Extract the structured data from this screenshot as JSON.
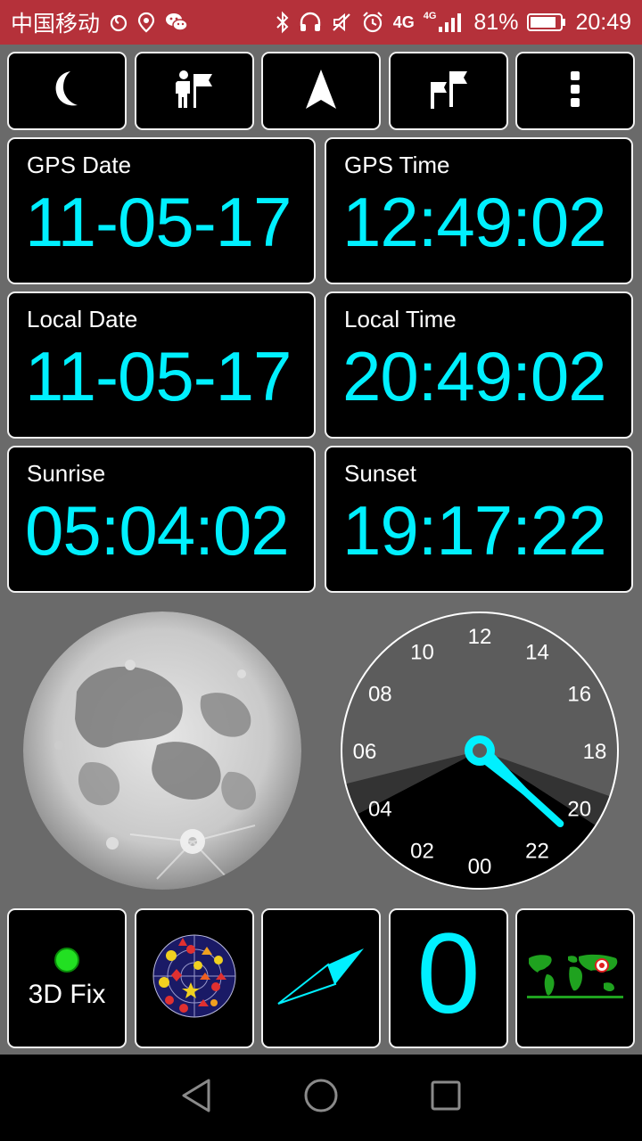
{
  "status_bar": {
    "carrier": "中国移动",
    "network": "4G",
    "network_small": "4G",
    "battery": "81%",
    "time": "20:49",
    "icons": [
      "shield-icon",
      "location-icon",
      "wechat-icon",
      "bluetooth-icon",
      "headphones-icon",
      "mute-icon",
      "alarm-icon",
      "signal-icon",
      "battery-icon"
    ]
  },
  "toolbar": {
    "buttons": [
      "moon-icon",
      "hiker-icon",
      "navigation-arrow-icon",
      "flags-icon",
      "more-vertical-icon"
    ]
  },
  "info": {
    "gps_date": {
      "label": "GPS Date",
      "value": "11-05-17"
    },
    "gps_time": {
      "label": "GPS Time",
      "value": "12:49:02"
    },
    "local_date": {
      "label": "Local Date",
      "value": "11-05-17"
    },
    "local_time": {
      "label": "Local Time",
      "value": "20:49:02"
    },
    "sunrise": {
      "label": "Sunrise",
      "value": "05:04:02"
    },
    "sunset": {
      "label": "Sunset",
      "value": "19:17:22"
    }
  },
  "clock24": {
    "hour_labels": [
      "00",
      "02",
      "04",
      "06",
      "08",
      "10",
      "12",
      "14",
      "16",
      "18",
      "20",
      "22"
    ],
    "hours": 20,
    "minutes": 49,
    "sunrise_hour": 5.07,
    "sunset_hour": 19.29
  },
  "bottom": {
    "fix_label": "3D Fix",
    "satellites": "0"
  },
  "colors": {
    "status_bar": "#b5313a",
    "accent_cyan": "#00f0ff",
    "fix_green": "#22e022",
    "background": "#6a6a6a"
  },
  "nav": {
    "buttons": [
      "back-icon",
      "home-icon",
      "recents-icon"
    ]
  }
}
